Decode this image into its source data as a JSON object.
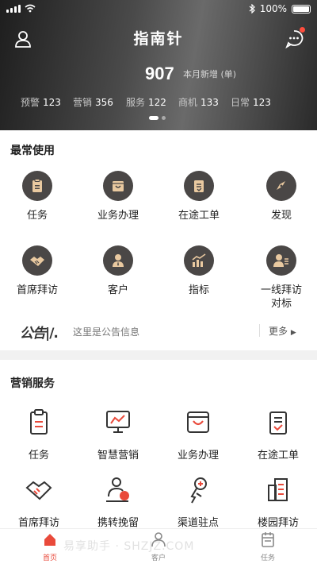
{
  "status_bar": {
    "battery": "100%"
  },
  "header": {
    "brand": "指南针",
    "big_count": "907",
    "big_label": "本月新增 (单)",
    "stats": [
      {
        "label": "预警",
        "value": "123"
      },
      {
        "label": "营销",
        "value": "356"
      },
      {
        "label": "服务",
        "value": "122"
      },
      {
        "label": "商机",
        "value": "133"
      },
      {
        "label": "日常",
        "value": "123"
      }
    ]
  },
  "frequent": {
    "title": "最常使用",
    "items": [
      {
        "label": "任务",
        "icon": "task-icon"
      },
      {
        "label": "业务办理",
        "icon": "business-icon"
      },
      {
        "label": "在途工单",
        "icon": "workorder-icon"
      },
      {
        "label": "发现",
        "icon": "compass-icon"
      },
      {
        "label": "首席拜访",
        "icon": "handshake-icon"
      },
      {
        "label": "客户",
        "icon": "customer-icon"
      },
      {
        "label": "指标",
        "icon": "chart-icon"
      },
      {
        "label": "一线拜访",
        "label2": "对标",
        "icon": "visit-icon"
      }
    ]
  },
  "notice": {
    "logo": "公告",
    "text": "这里是公告信息",
    "more": "更多"
  },
  "marketing": {
    "title": "营销服务",
    "items": [
      {
        "label": "任务",
        "icon": "task-icon"
      },
      {
        "label": "智慧营销",
        "icon": "smart-marketing-icon"
      },
      {
        "label": "业务办理",
        "icon": "business-icon"
      },
      {
        "label": "在途工单",
        "icon": "workorder-icon"
      },
      {
        "label": "首席拜访",
        "icon": "handshake-icon"
      },
      {
        "label": "携转挽留",
        "icon": "retention-icon"
      },
      {
        "label": "渠道驻点",
        "icon": "location-icon"
      },
      {
        "label": "楼园拜访",
        "icon": "building-icon"
      }
    ]
  },
  "tabbar": {
    "tabs": [
      {
        "label": "首页",
        "active": true
      },
      {
        "label": "客户",
        "active": false
      },
      {
        "label": "任务",
        "active": false
      }
    ]
  },
  "watermark": "易享助手 · SHZJZ.COM",
  "colors": {
    "accent": "#e94a3b",
    "icon_bg": "#4a4746",
    "icon_fg": "#e9c9a0"
  }
}
